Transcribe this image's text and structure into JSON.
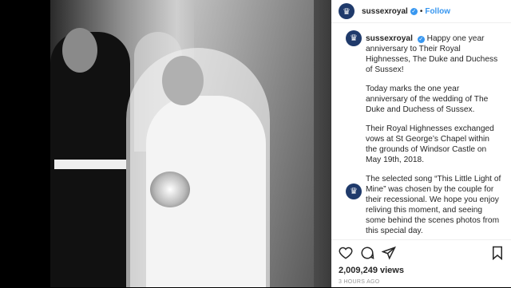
{
  "post": {
    "username": "sussexroyal",
    "verified_mark": "✓",
    "dot": "•",
    "follow_label": "Follow",
    "caption": {
      "first": "Happy one year anniversary to Their Royal Highnesses, The Duke and Duchess of Sussex!",
      "p2": "Today marks the one year anniversary of the wedding of The Duke and Duchess of Sussex.",
      "p3": "Their Royal Highnesses exchanged vows at St George’s Chapel within the grounds of Windsor Castle on May 19th, 2018.",
      "p4": "The selected song “This Little Light of Mine” was chosen by the couple for their recessional. We hope you enjoy reliving this moment, and seeing some behind the scenes photos from this special day."
    },
    "likes": "2,009,249 views",
    "time_ago": "3 HOURS AGO"
  },
  "icons": {
    "avatar": "crest-icon",
    "like": "heart-icon",
    "comment": "comment-icon",
    "share": "share-icon",
    "save": "bookmark-icon"
  }
}
